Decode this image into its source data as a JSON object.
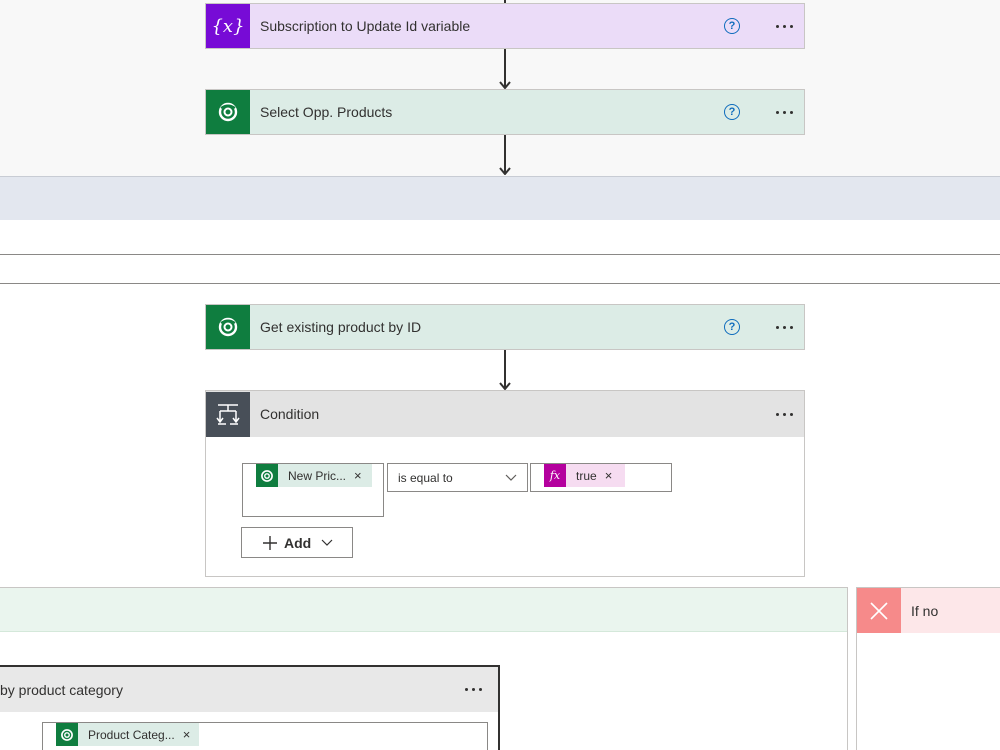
{
  "actions": {
    "subscription": {
      "title": "Subscription to Update Id variable",
      "icon": "variable-icon",
      "icon_text": "{x}",
      "help": "?"
    },
    "select_products": {
      "title": "Select Opp. Products",
      "icon": "dataverse-icon",
      "help": "?"
    },
    "get_product": {
      "title": "Get existing product by ID",
      "icon": "dataverse-icon",
      "help": "?"
    }
  },
  "condition": {
    "title": "Condition",
    "icon": "condition-icon",
    "left_token": "New Pric...",
    "operator": "is equal to",
    "right_token": "true",
    "right_token_icon_text": "fx",
    "add_label": "Add"
  },
  "branches": {
    "no_label": "If no",
    "yes_label": ""
  },
  "switch": {
    "title": "by product category",
    "token": "Product Categ..."
  },
  "colors": {
    "purple_icon": "#770bd6",
    "purple_bg": "#ebdcf8",
    "green_icon": "#0f7d3f",
    "green_bg": "#dcece6",
    "help_blue": "#0f6cbd",
    "expression_pink": "#b4009e",
    "no_red": "#f68a8a"
  }
}
